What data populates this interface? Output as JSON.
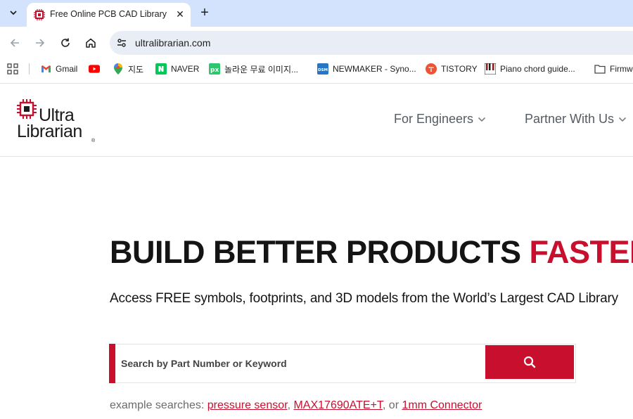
{
  "browser": {
    "tab_title": "Free Online PCB CAD Library |",
    "url": "ultralibrarian.com"
  },
  "bookmarks": [
    {
      "label": "Gmail",
      "icon": "gmail-icon"
    },
    {
      "label": "",
      "icon": "youtube-icon"
    },
    {
      "label": "지도",
      "icon": "maps-icon"
    },
    {
      "label": "NAVER",
      "icon": "naver-icon"
    },
    {
      "label": "놀라운 무료 이미지...",
      "icon": "pixabay-icon"
    },
    {
      "label": "NEWMAKER - Syno...",
      "icon": "dsm-icon"
    },
    {
      "label": "TISTORY",
      "icon": "tistory-icon"
    },
    {
      "label": "Piano chord guide...",
      "icon": "piano-icon"
    },
    {
      "label": "Firmw",
      "icon": "folder-icon"
    }
  ],
  "site": {
    "logo_line1": "Ultra",
    "logo_line2": "Librarian",
    "logo_tm": "®",
    "nav": [
      {
        "label": "For Engineers"
      },
      {
        "label": "Partner With Us"
      }
    ]
  },
  "hero": {
    "title_main": "BUILD BETTER PRODUCTS",
    "title_accent": "FASTER",
    "subtitle": "Access FREE symbols, footprints, and 3D models from the World’s Largest CAD Library"
  },
  "search": {
    "placeholder": "Search by Part Number or Keyword"
  },
  "examples": {
    "prefix": "example searches: ",
    "items": [
      "pressure sensor",
      "MAX17690ATE+T",
      "1mm Connector"
    ],
    "sep1": ", ",
    "sep2": ", or "
  },
  "colors": {
    "brand_red": "#c8102e",
    "chrome_blue": "#d3e3fd"
  }
}
